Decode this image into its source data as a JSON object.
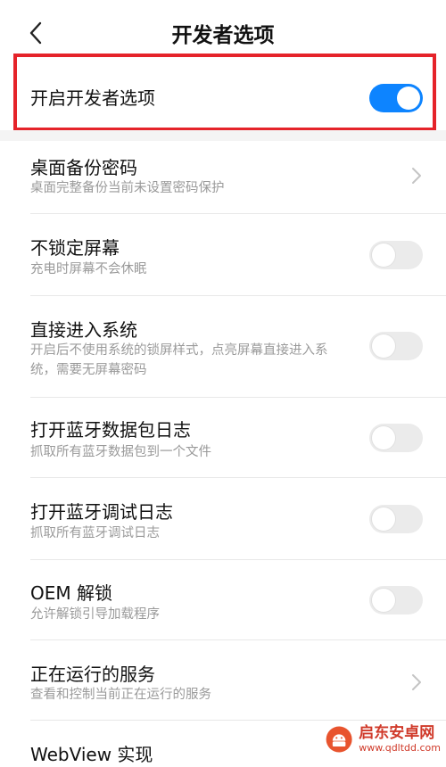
{
  "header": {
    "title": "开发者选项",
    "back_icon": "chevron-left-icon"
  },
  "developer_toggle": {
    "label": "开启开发者选项",
    "on": true
  },
  "colors": {
    "accent": "#0d84ff",
    "highlight_border": "#e5232a",
    "subtitle": "#9a9a9a"
  },
  "items": [
    {
      "title": "桌面备份密码",
      "subtitle": "桌面完整备份当前未设置密码保护",
      "control": "chevron"
    },
    {
      "title": "不锁定屏幕",
      "subtitle": "充电时屏幕不会休眠",
      "control": "toggle",
      "on": false
    },
    {
      "title": "直接进入系统",
      "subtitle": "开启后不使用系统的锁屏样式，点亮屏幕直接进入系统，需要无屏幕密码",
      "control": "toggle",
      "on": false
    },
    {
      "title": "打开蓝牙数据包日志",
      "subtitle": "抓取所有蓝牙数据包到一个文件",
      "control": "toggle",
      "on": false
    },
    {
      "title": "打开蓝牙调试日志",
      "subtitle": "抓取所有蓝牙调试日志",
      "control": "toggle",
      "on": false
    },
    {
      "title": "OEM 解锁",
      "subtitle": "允许解锁引导加载程序",
      "control": "toggle",
      "on": false
    },
    {
      "title": "正在运行的服务",
      "subtitle": "查看和控制当前正在运行的服务",
      "control": "chevron"
    },
    {
      "title": "WebView 实现",
      "subtitle": "",
      "control": "none"
    }
  ],
  "watermark": {
    "name": "启东安卓网",
    "url": "www.qdltdd.com"
  }
}
